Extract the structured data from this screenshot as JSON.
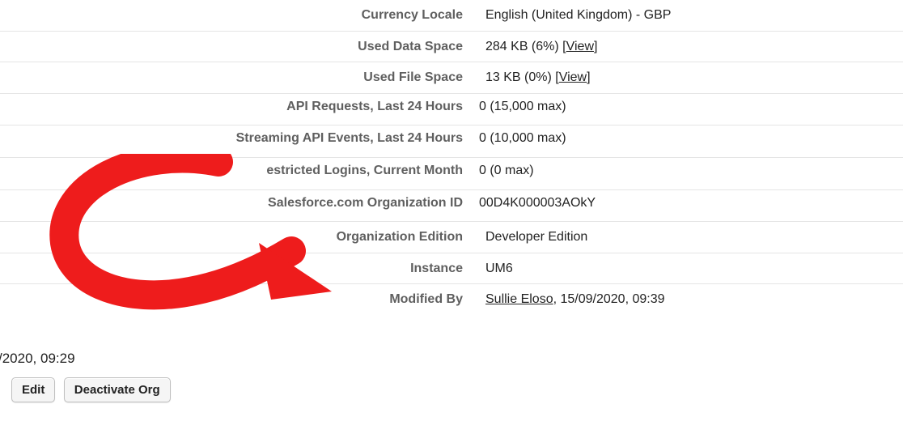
{
  "rows": {
    "currency_locale": {
      "label": "Currency Locale",
      "value": "English (United Kingdom) - GBP"
    },
    "used_data_space": {
      "label": "Used Data Space",
      "value_prefix": "284 KB (6%) ",
      "view": "View"
    },
    "used_file_space": {
      "label": "Used File Space",
      "value_prefix": "13 KB (0%) ",
      "view": "View"
    },
    "api_requests": {
      "label": "API Requests, Last 24 Hours",
      "value": "0 (15,000 max)"
    },
    "stream_events": {
      "label": "Streaming API Events, Last 24 Hours",
      "value": "0 (10,000 max)"
    },
    "restricted_logins": {
      "label": "estricted Logins, Current Month",
      "value": "0 (0 max)"
    },
    "org_id": {
      "label": "Salesforce.com Organization ID",
      "value": "00D4K000003AOkY"
    },
    "edition": {
      "label": "Organization Edition",
      "value": "Developer Edition"
    },
    "instance": {
      "label": "Instance",
      "value": "UM6"
    },
    "modified_by": {
      "label": "Modified By",
      "user": "Sullie Eloso",
      "tail": ", 15/09/2020, 09:39"
    }
  },
  "left_timestamp": "/2020, 09:29",
  "buttons": {
    "edit": "Edit",
    "deactivate": "Deactivate Org"
  }
}
